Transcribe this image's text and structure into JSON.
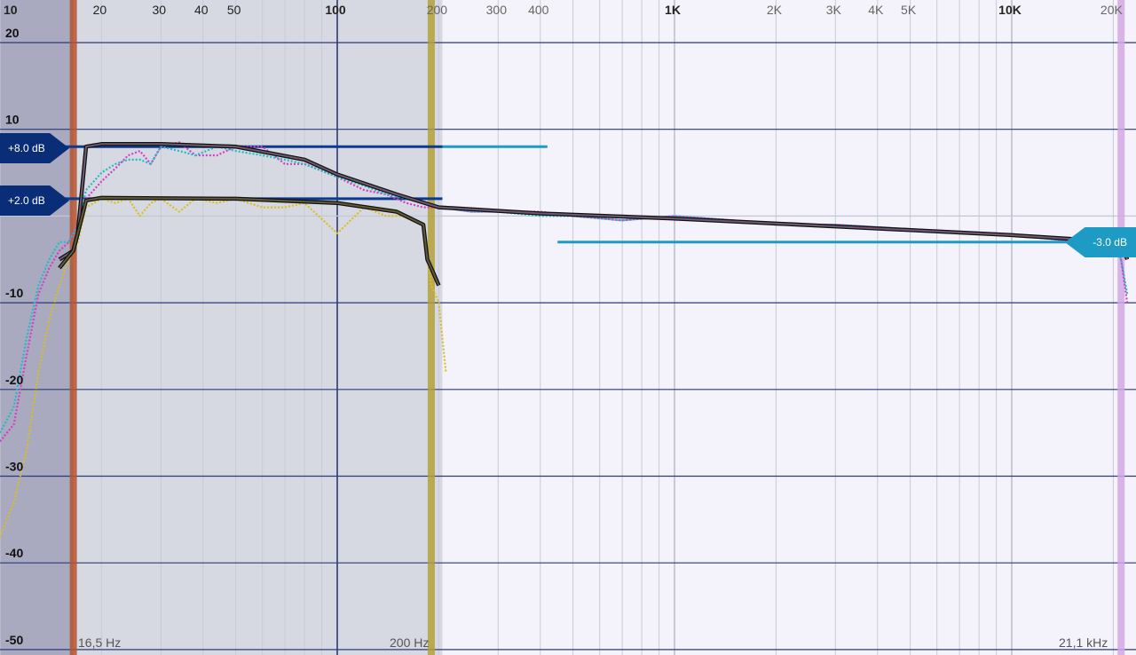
{
  "chart_data": {
    "type": "line",
    "title": "",
    "xlabel": "",
    "ylabel": "",
    "x_scale": "log",
    "xlim": [
      10,
      22000
    ],
    "ylim": [
      -50,
      20
    ],
    "x_tick_labels": [
      {
        "v": 10,
        "t": "10"
      },
      {
        "v": 20,
        "t": "20"
      },
      {
        "v": 30,
        "t": "30"
      },
      {
        "v": 40,
        "t": "40"
      },
      {
        "v": 50,
        "t": "50"
      },
      {
        "v": 100,
        "t": "100"
      },
      {
        "v": 200,
        "t": "200"
      },
      {
        "v": 300,
        "t": "300"
      },
      {
        "v": 400,
        "t": "400"
      },
      {
        "v": 1000,
        "t": "1K"
      },
      {
        "v": 2000,
        "t": "2K"
      },
      {
        "v": 3000,
        "t": "3K"
      },
      {
        "v": 4000,
        "t": "4K"
      },
      {
        "v": 5000,
        "t": "5K"
      },
      {
        "v": 10000,
        "t": "10K"
      },
      {
        "v": 20000,
        "t": "20K"
      }
    ],
    "y_tick_labels": [
      {
        "v": 20,
        "t": "20"
      },
      {
        "v": 10,
        "t": "10"
      },
      {
        "v": -10,
        "t": "-10"
      },
      {
        "v": -20,
        "t": "-20"
      },
      {
        "v": -30,
        "t": "-30"
      },
      {
        "v": -40,
        "t": "-40"
      },
      {
        "v": -50,
        "t": "-50"
      }
    ],
    "bands": [
      {
        "name": "left-shaded",
        "x_from": 10,
        "x_to": 16.5,
        "color": "#a9a9bf"
      },
      {
        "name": "crossover-region",
        "x_from": 16.5,
        "x_to": 205,
        "color": "#d7d9e2"
      }
    ],
    "markers": [
      {
        "x": 16.5,
        "color": "#b5552f"
      },
      {
        "x": 190,
        "color": "#b3a038"
      },
      {
        "x": 21100,
        "color": "#d3a6e3"
      }
    ],
    "corner_labels": {
      "low_cutoff": "16,5 Hz",
      "crossover": "200 Hz",
      "high_cutoff": "21,1 kHz"
    },
    "gain_flags": {
      "upper": "+8.0 dB",
      "lower": "+2.0 dB",
      "right": "-3.0 dB"
    },
    "target_lines": [
      {
        "name": "upper-target",
        "x_from": 10,
        "x_to": 205,
        "y": 8,
        "color": "#0b3a8f"
      },
      {
        "name": "upper-target-ext",
        "x_from": 205,
        "x_to": 420,
        "y": 8,
        "color": "#1e9bc5"
      },
      {
        "name": "lower-target",
        "x_from": 10,
        "x_to": 205,
        "y": 2,
        "color": "#0b3a8f"
      },
      {
        "name": "right-target",
        "x_from": 450,
        "x_to": 21100,
        "y": -3,
        "color": "#1e9bc5"
      }
    ],
    "series": [
      {
        "color": "#d63cc8",
        "style": "dotted",
        "x": [
          10,
          11,
          12,
          13,
          14,
          15,
          16,
          17,
          18,
          20,
          22,
          24,
          26,
          28,
          30,
          34,
          38,
          44,
          50,
          60,
          70,
          80,
          100,
          120,
          140,
          160,
          180,
          200,
          250,
          300,
          400,
          500,
          700,
          1000,
          1500,
          2000,
          3000,
          5000,
          8000,
          12000,
          16000,
          20000,
          21100,
          22000
        ],
        "y": [
          -26,
          -24,
          -16,
          -9,
          -6,
          -4,
          -3,
          -1,
          2,
          4,
          5.5,
          7,
          7.5,
          6,
          8,
          8.5,
          7,
          7,
          8,
          8,
          6,
          6,
          4.5,
          3,
          2.5,
          1.5,
          1,
          1,
          0.5,
          0.5,
          0.5,
          0,
          -0.5,
          0,
          -0.5,
          -1,
          -1,
          -1.5,
          -2,
          -2.5,
          -3,
          -3,
          -5,
          -10
        ]
      },
      {
        "color": "#21bcc0",
        "style": "dotted",
        "x": [
          10,
          11,
          12,
          13,
          14,
          15,
          16,
          17,
          18,
          20,
          22,
          24,
          26,
          28,
          30,
          34,
          38,
          44,
          50,
          60,
          70,
          80,
          100,
          120,
          140,
          160,
          180,
          200,
          250,
          300,
          400,
          500,
          700,
          1000,
          1500,
          2000,
          3000,
          5000,
          8000,
          12000,
          16000,
          20000,
          21100,
          22000
        ],
        "y": [
          -25,
          -22,
          -14,
          -8,
          -5,
          -3,
          -3,
          -1,
          3,
          5,
          6,
          6.5,
          6.5,
          6,
          8,
          7.5,
          7,
          8,
          7.5,
          7,
          6.5,
          6,
          4.5,
          3.5,
          2.5,
          2,
          1.5,
          1,
          0.5,
          0.5,
          0,
          0,
          -0.5,
          0,
          -0.5,
          -1,
          -1,
          -1.5,
          -2,
          -2.5,
          -3,
          -3,
          -5,
          -9
        ]
      },
      {
        "color": "#d9bf1a",
        "style": "dotted",
        "x": [
          10,
          11,
          12,
          13,
          14,
          15,
          16,
          17,
          18,
          20,
          22,
          24,
          26,
          28,
          30,
          34,
          38,
          44,
          50,
          60,
          70,
          80,
          100,
          120,
          140,
          160,
          180,
          190,
          200,
          210
        ],
        "y": [
          -37,
          -33,
          -27,
          -18,
          -12,
          -8,
          -5,
          -3,
          1,
          2,
          1.5,
          2,
          0,
          1.5,
          2,
          0.5,
          2,
          1.5,
          2,
          1,
          1,
          1.5,
          -2,
          1,
          0,
          0,
          -1,
          -8,
          -10,
          -18
        ]
      },
      {
        "color": "#6d5a72",
        "style": "solid",
        "x": [
          15,
          16.5,
          17,
          18,
          20,
          30,
          50,
          80,
          100,
          150,
          200,
          400,
          1000,
          3000,
          10000,
          21100,
          22000
        ],
        "y": [
          -5,
          -4,
          -2,
          8,
          8.3,
          8.3,
          8,
          6.5,
          4.8,
          2.5,
          1,
          0.3,
          -0.3,
          -1.2,
          -2.2,
          -3,
          -5
        ]
      },
      {
        "color": "#5e5a3a",
        "style": "solid",
        "x": [
          15,
          16.5,
          17,
          18,
          20,
          50,
          100,
          150,
          180,
          185,
          190,
          195,
          200
        ],
        "y": [
          -6,
          -4,
          -2,
          1.8,
          2.1,
          2,
          1.5,
          0.5,
          -1,
          -5,
          -6,
          -7,
          -8
        ]
      }
    ]
  }
}
